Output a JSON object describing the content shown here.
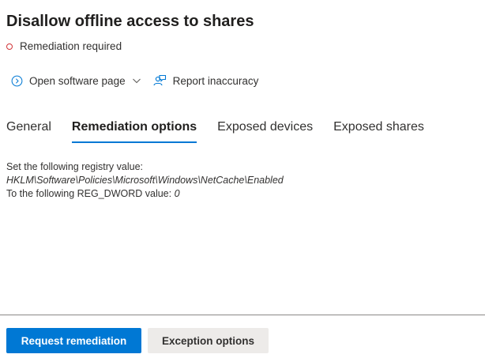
{
  "header": {
    "title": "Disallow offline access to shares",
    "status": "Remediation required"
  },
  "actions": {
    "open_software": "Open software page",
    "report": "Report inaccuracy"
  },
  "tabs": [
    {
      "label": "General",
      "active": false
    },
    {
      "label": "Remediation options",
      "active": true
    },
    {
      "label": "Exposed devices",
      "active": false
    },
    {
      "label": "Exposed shares",
      "active": false
    }
  ],
  "content": {
    "line1": "Set the following registry value:",
    "path": "HKLM\\Software\\Policies\\Microsoft\\Windows\\NetCache\\Enabled",
    "line3_prefix": "To the following REG_DWORD value: ",
    "value": "0"
  },
  "footer": {
    "primary": "Request remediation",
    "secondary": "Exception options"
  },
  "colors": {
    "accent": "#0078d4",
    "status_red": "#d13438"
  },
  "icons": {
    "open_software": "circle-chevron-right-icon",
    "dropdown": "chevron-down-icon",
    "report": "person-feedback-icon",
    "status": "status-circle-icon"
  }
}
